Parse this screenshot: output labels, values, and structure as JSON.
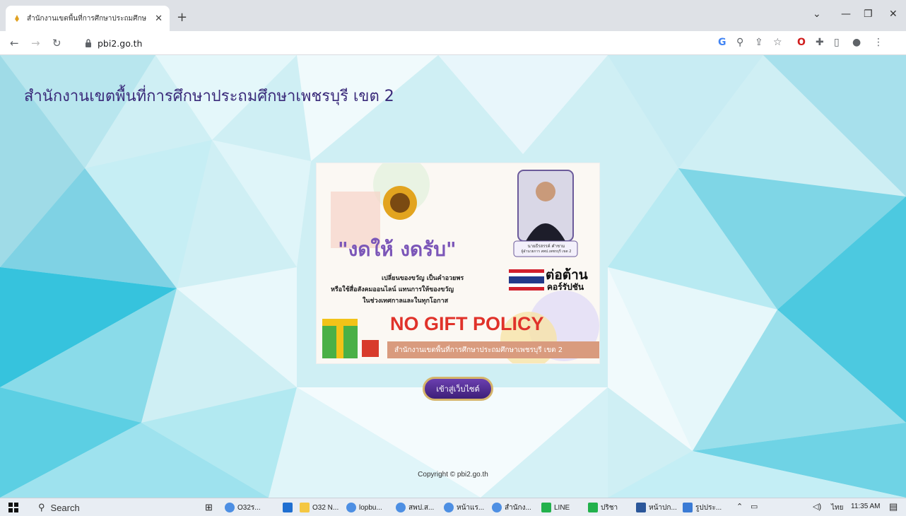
{
  "browser": {
    "tab_title": "สำนักงานเขตพื้นที่การศึกษาประถมศึกษ",
    "tab_close": "✕",
    "new_tab": "+",
    "url": "pbi2.go.th",
    "window_controls": {
      "dropdown": "⌄",
      "minimize": "—",
      "restore": "❐",
      "close": "✕"
    }
  },
  "page": {
    "title": "สำนักงานเขตพื้นที่การศึกษาประถมศึกษาเพชรบุรี เขต 2",
    "poster": {
      "quote": "\"งดให้ งดรับ\"",
      "lines": [
        "เปลี่ยนของขวัญ  เป็นคำอวยพร",
        "หรือใช้สื่อสังคมออนไลน์  แทนการให้ของขวัญ",
        "ในช่วงเทศกาลและในทุกโอกาส"
      ],
      "person_caption_1": "นายธีรสรรค์  คำชาม",
      "person_caption_2": "ผู้อำนวยการ สพป.เพชรบุรี เขต 2",
      "anti_corruption_1": "ต่อต้าน",
      "anti_corruption_2": "คอร์รัปชัน",
      "headline": "NO GIFT POLICY",
      "org_banner": "สำนักงานเขตพื้นที่การศึกษาประถมศึกษาเพชรบุรี เขต 2"
    },
    "enter_button": "เข้าสู่เว็บไซต์",
    "copyright": "Copyright © pbi2.go.th"
  },
  "taskbar": {
    "search": "Search",
    "items": [
      "O32ร...",
      "O32 N...",
      "lopbu...",
      "สพป.ส...",
      "หน้าแร...",
      "สำนักง...",
      "LINE",
      "ปริชา",
      "หน้าปก...",
      "รูปประ..."
    ],
    "lang": "ไทย",
    "time": "11:35 AM"
  }
}
